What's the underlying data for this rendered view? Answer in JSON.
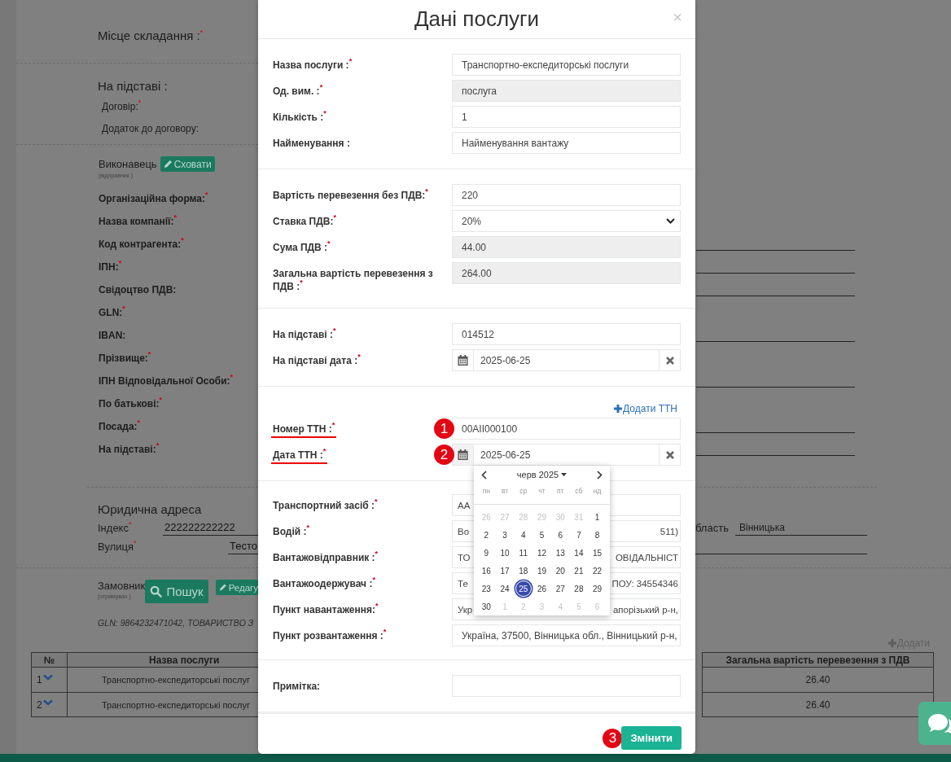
{
  "background": {
    "place": {
      "label": "Місце складання :$^{*}$"
    },
    "basis": {
      "title": "На підставі :",
      "fields": [
        "Договір:$^{*}$",
        "Додаток до договору:"
      ]
    },
    "executor": {
      "title": "Виконавець",
      "subtitle": "(відправник )",
      "button": "Сховати",
      "fields": [
        {
          "label": "Організаційна форма:$^{*}$",
          "input": false
        },
        {
          "label": "Назва компанії:$^{*}$",
          "input": false
        },
        {
          "label": "Код контрагента:$^{*}$",
          "input": true
        },
        {
          "label": "ІПН:$^{*}$",
          "input": true
        },
        {
          "label": "Свідоцтво ПДВ:",
          "input": true
        },
        {
          "label": "GLN:$^{*}$",
          "input": false
        },
        {
          "label": "IBAN:",
          "input": true
        },
        {
          "label": "Прізвище:$^{*}$",
          "input": false
        },
        {
          "label": "ІПН Відповідальної Особи:$^{*}$",
          "input": true
        },
        {
          "label": "По батькові:$^{*}$",
          "input": false
        },
        {
          "label": "Посада:$^{*}$",
          "input": true
        },
        {
          "label": "На підставі:$^{*}$",
          "input": true
        }
      ]
    },
    "legal_address": {
      "title": "Юридична адреса",
      "fields": [
        {
          "label": "Індекс$^{*}$",
          "value": "222222222222"
        },
        {
          "label": "Вулиця$^{*}$",
          "value": "Тесто"
        }
      ],
      "region": {
        "label": "бласть",
        "value": "Вінницька"
      }
    },
    "customer": {
      "title": "Замовник",
      "subtitle": "(отримувач )",
      "search_button": "Пошук",
      "edit_button": "Редагу",
      "summary": "GLN: 9864232471042, ТОВАРИСТВО З"
    },
    "services": {
      "add_link": "Додати",
      "columns": [
        "№",
        "Назва послуги",
        "Загальна вартість перевезення з ПДВ"
      ],
      "rows": [
        {
          "number": "1",
          "name": "Транспортно-експедиторські послуг",
          "total": "26.40"
        },
        {
          "number": "2",
          "name": "Транспортно-експедиторські послуг",
          "total": "26.40"
        }
      ]
    }
  },
  "modal": {
    "title": "Дані послуги",
    "close": "×",
    "sections": [
      {
        "rows": [
          {
            "kind": "text",
            "label": "Назва послуги :$^{*}$",
            "value": "Транспортно-експедиторські послуги",
            "readonly": false,
            "highlighted": false
          },
          {
            "kind": "text",
            "label": "Од. вим. :$^{*}$",
            "value": "послуга",
            "readonly": true,
            "highlighted": false
          },
          {
            "kind": "text",
            "label": "Кількість :$^{*}$",
            "value": "1",
            "readonly": false,
            "highlighted": false
          },
          {
            "kind": "text",
            "label": "Найменування :",
            "value": "Найменування вантажу",
            "readonly": false,
            "highlighted": false
          }
        ]
      },
      {
        "rows": [
          {
            "kind": "text",
            "label": "Вартість перевезення без ПДВ:$^{*}$",
            "value": "220",
            "readonly": false,
            "highlighted": false
          },
          {
            "kind": "select",
            "label": "Ставка ПДВ:$^{*}$",
            "value": "20%",
            "highlighted": false
          },
          {
            "kind": "text",
            "label": "Сума ПДВ :$^{*}$",
            "value": "44.00",
            "readonly": true,
            "highlighted": false
          },
          {
            "kind": "text",
            "label": "Загальна вартість перевезення з ПДВ :$^{*}$",
            "value": "264.00",
            "readonly": true,
            "highlighted": false
          }
        ]
      },
      {
        "rows": [
          {
            "kind": "text",
            "label": "На підставі :$^{*}$",
            "value": "014512",
            "readonly": false,
            "highlighted": false
          },
          {
            "kind": "date",
            "label": "На підставі дата :$^{*}$",
            "value": "2025-06-25",
            "calendar_open": false,
            "highlighted": false
          }
        ]
      },
      {
        "add_link": "Додати ТТН",
        "rows": [
          {
            "kind": "text",
            "label": "Номер ТТН :$^{*}$",
            "value": "00AII000100",
            "readonly": false,
            "highlighted": true,
            "badge": "1"
          },
          {
            "kind": "date",
            "label": "Дата ТТН :$^{*}$",
            "value": "2025-06-25",
            "calendar_open": true,
            "highlighted": true,
            "badge": "2"
          }
        ]
      },
      {
        "rows": [
          {
            "kind": "split",
            "label": "Транспортний засіб :$^{*}$",
            "value_start": "АА",
            "highlighted": false
          },
          {
            "kind": "split",
            "label": "Водій :$^{*}$",
            "value_start": "Во",
            "value_end": "511)",
            "highlighted": false
          },
          {
            "kind": "split",
            "label": "Вантажовідправник :$^{*}$",
            "value_start": "ТО",
            "value_end": "ОВІДАЛЬНІСТ",
            "highlighted": false
          },
          {
            "kind": "split",
            "label": "Вантажоодержувач :$^{*}$",
            "value_start": "Те",
            "value_end": "ПОУ: 34554346",
            "highlighted": false
          },
          {
            "kind": "split",
            "label": "Пункт навантаження:$^{*}$",
            "value_start": "Укр",
            "value_end": "апорізький р-н,",
            "highlighted": false
          },
          {
            "kind": "text",
            "label": "Пункт розвантаження :$^{*}$",
            "value": "Україна, 37500, Вінницька обл., Вінницький р-н,",
            "readonly": false,
            "highlighted": false
          }
        ]
      },
      {
        "rows": [
          {
            "kind": "text",
            "label": "Примітка:",
            "readonly": false,
            "highlighted": false
          }
        ]
      }
    ],
    "calendar": {
      "month": "черв 2025",
      "weekdays": [
        "пн",
        "вт",
        "ср",
        "чт",
        "пт",
        "сб",
        "нд"
      ],
      "weeks": [
        [
          {
            "day": "26",
            "muted": true,
            "selected": false
          },
          {
            "day": "27",
            "muted": true,
            "selected": false
          },
          {
            "day": "28",
            "muted": true,
            "selected": false
          },
          {
            "day": "29",
            "muted": true,
            "selected": false
          },
          {
            "day": "30",
            "muted": true,
            "selected": false
          },
          {
            "day": "31",
            "muted": true,
            "selected": false
          },
          {
            "day": "1",
            "muted": false,
            "selected": false
          }
        ],
        [
          {
            "day": "2",
            "muted": false,
            "selected": false
          },
          {
            "day": "3",
            "muted": false,
            "selected": false
          },
          {
            "day": "4",
            "muted": false,
            "selected": false
          },
          {
            "day": "5",
            "muted": false,
            "selected": false
          },
          {
            "day": "6",
            "muted": false,
            "selected": false
          },
          {
            "day": "7",
            "muted": false,
            "selected": false
          },
          {
            "day": "8",
            "muted": false,
            "selected": false
          }
        ],
        [
          {
            "day": "9",
            "muted": false,
            "selected": false
          },
          {
            "day": "10",
            "muted": false,
            "selected": false
          },
          {
            "day": "11",
            "muted": false,
            "selected": false
          },
          {
            "day": "12",
            "muted": false,
            "selected": false
          },
          {
            "day": "13",
            "muted": false,
            "selected": false
          },
          {
            "day": "14",
            "muted": false,
            "selected": false
          },
          {
            "day": "15",
            "muted": false,
            "selected": false
          }
        ],
        [
          {
            "day": "16",
            "muted": false,
            "selected": false
          },
          {
            "day": "17",
            "muted": false,
            "selected": false
          },
          {
            "day": "18",
            "muted": false,
            "selected": false
          },
          {
            "day": "19",
            "muted": false,
            "selected": false
          },
          {
            "day": "20",
            "muted": false,
            "selected": false
          },
          {
            "day": "21",
            "muted": false,
            "selected": false
          },
          {
            "day": "22",
            "muted": false,
            "selected": false
          }
        ],
        [
          {
            "day": "23",
            "muted": false,
            "selected": false
          },
          {
            "day": "24",
            "muted": false,
            "selected": false
          },
          {
            "day": "25",
            "muted": false,
            "selected": true
          },
          {
            "day": "26",
            "muted": false,
            "selected": false
          },
          {
            "day": "27",
            "muted": false,
            "selected": false
          },
          {
            "day": "28",
            "muted": false,
            "selected": false
          },
          {
            "day": "29",
            "muted": false,
            "selected": false
          }
        ],
        [
          {
            "day": "30",
            "muted": false,
            "selected": false
          },
          {
            "day": "1",
            "muted": true,
            "selected": false
          },
          {
            "day": "2",
            "muted": true,
            "selected": false
          },
          {
            "day": "3",
            "muted": true,
            "selected": false
          },
          {
            "day": "4",
            "muted": true,
            "selected": false
          },
          {
            "day": "5",
            "muted": true,
            "selected": false
          },
          {
            "day": "6",
            "muted": true,
            "selected": false
          }
        ]
      ]
    },
    "footer": {
      "submit": "Змінити",
      "badge": "3"
    }
  }
}
